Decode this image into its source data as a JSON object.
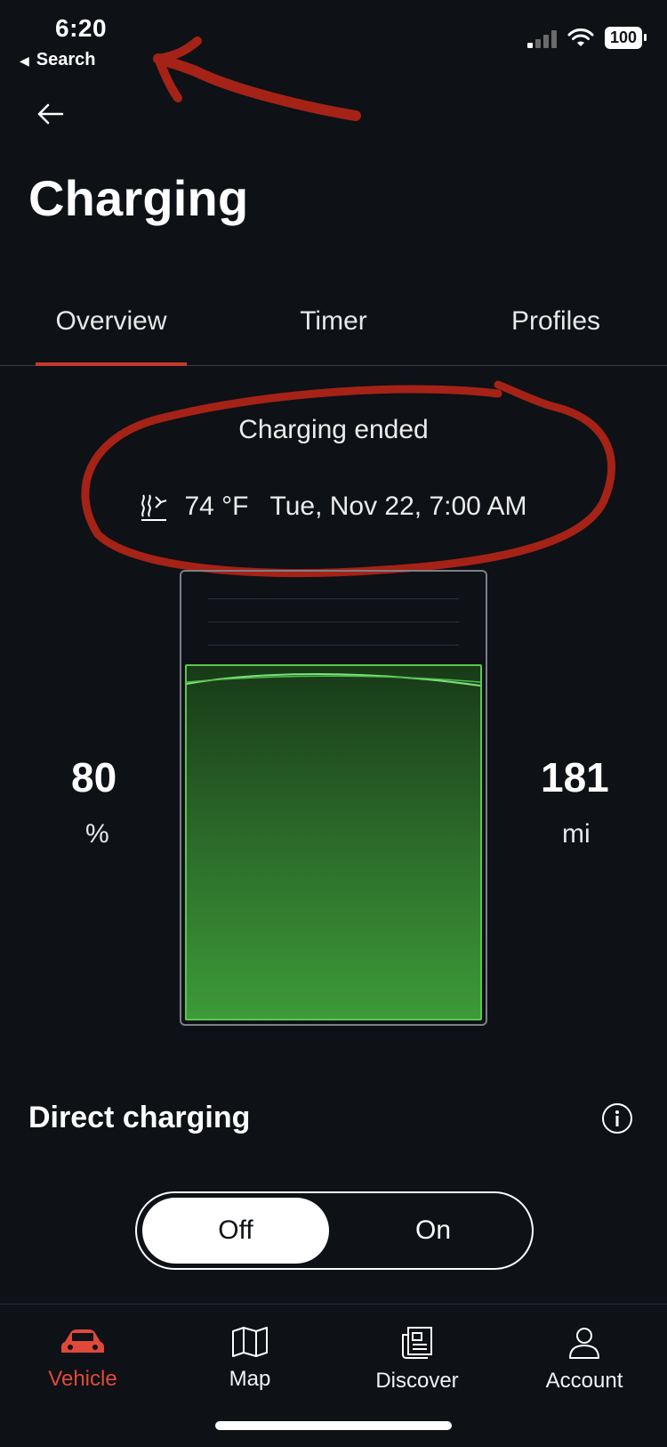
{
  "status_bar": {
    "time": "6:20",
    "back_app": "Search",
    "battery": "100"
  },
  "header": {
    "title": "Charging"
  },
  "tabs": [
    {
      "label": "Overview",
      "active": true
    },
    {
      "label": "Timer",
      "active": false
    },
    {
      "label": "Profiles",
      "active": false
    }
  ],
  "charge_info": {
    "status_text": "Charging ended",
    "temperature": "74 °F",
    "datetime": "Tue, Nov 22, 7:00 AM"
  },
  "battery": {
    "soc_value": "80",
    "soc_unit": "%",
    "range_value": "181",
    "range_unit": "mi",
    "fill_fraction": 0.8
  },
  "direct_charging": {
    "title": "Direct charging",
    "toggle_off": "Off",
    "toggle_on": "On",
    "selected": "Off"
  },
  "nav": [
    {
      "label": "Vehicle",
      "icon": "car-icon",
      "active": true
    },
    {
      "label": "Map",
      "icon": "map-icon",
      "active": false
    },
    {
      "label": "Discover",
      "icon": "news-icon",
      "active": false
    },
    {
      "label": "Account",
      "icon": "user-icon",
      "active": false
    }
  ],
  "colors": {
    "background": "#0e1116",
    "accent": "#c73a2b",
    "nav_active": "#e0493a",
    "battery_fill": "#3c9b38"
  }
}
